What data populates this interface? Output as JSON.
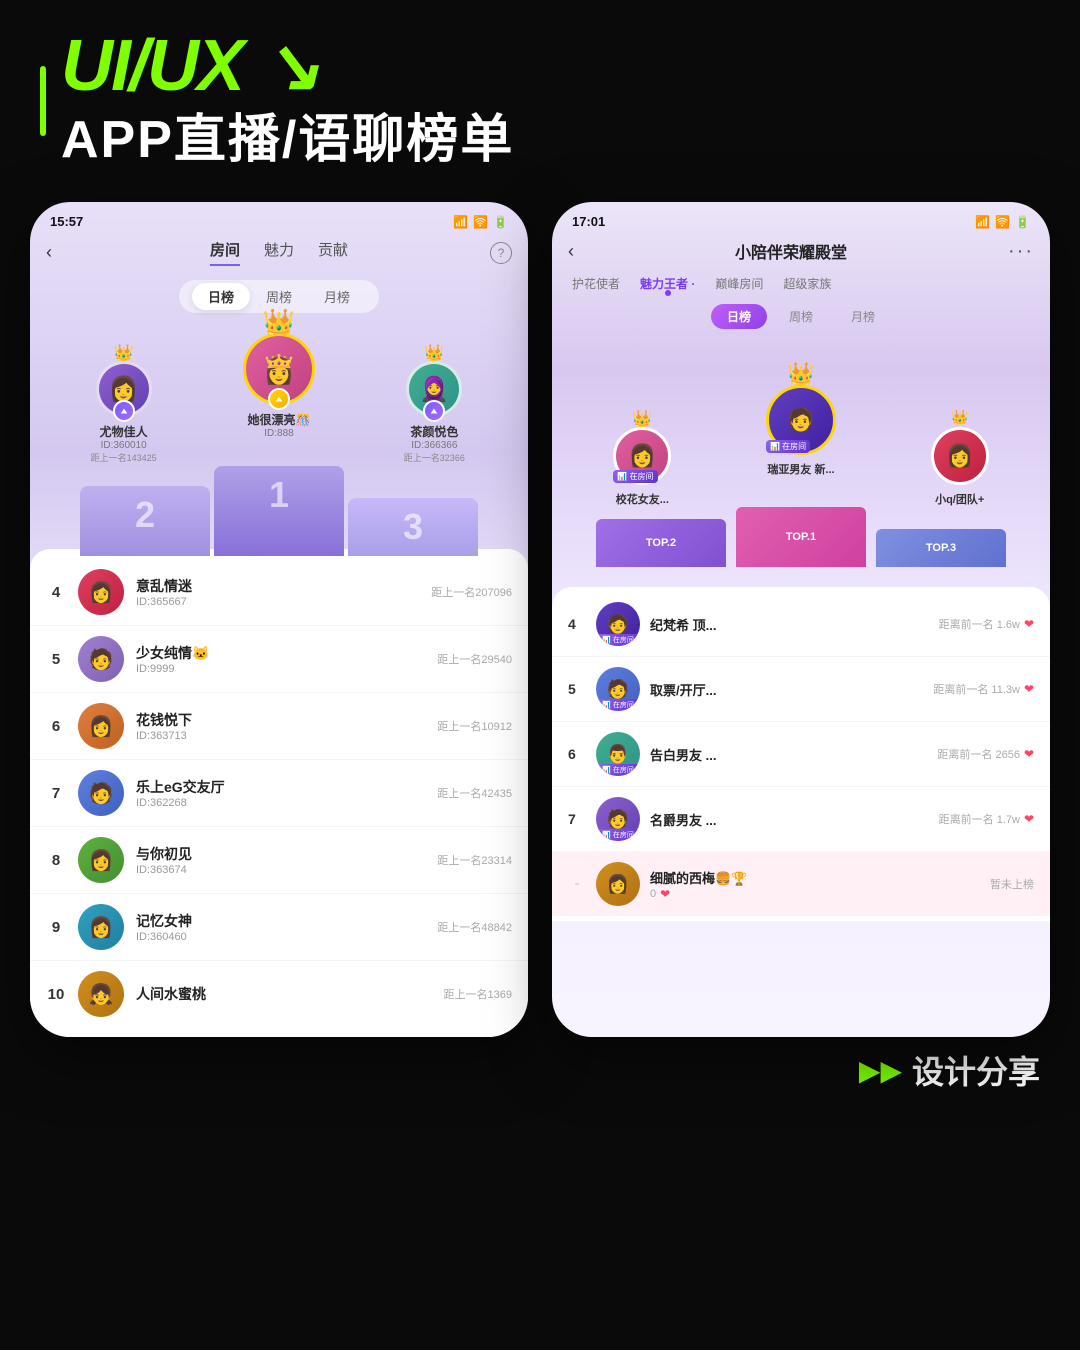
{
  "header": {
    "bar_color": "#7fff00",
    "title_uiux": "UI/UX ↘",
    "title_sub": "APP直播/语聊榜单"
  },
  "phone1": {
    "status_time": "15:57",
    "nav_tabs": [
      "房间",
      "魅力",
      "贡献"
    ],
    "active_nav": "房间",
    "period_tabs": [
      "日榜",
      "周榜",
      "月榜"
    ],
    "active_period": "日榜",
    "podium": [
      {
        "rank": 2,
        "name": "尤物佳人",
        "id": "ID:360010",
        "dist": "距上一名143425",
        "emoji": "👩"
      },
      {
        "rank": 1,
        "name": "她很漂亮🎊",
        "id": "ID:888",
        "dist": "",
        "emoji": "👸"
      },
      {
        "rank": 3,
        "name": "茶颜悦色",
        "id": "ID:366366",
        "dist": "距上一名32366",
        "emoji": "🧕"
      }
    ],
    "list": [
      {
        "rank": 4,
        "name": "意乱情迷",
        "id": "ID:365667",
        "dist": "距上一名207096",
        "emoji": "👩"
      },
      {
        "rank": 5,
        "name": "少女纯情🐱",
        "id": "ID:9999",
        "dist": "距上一名29540",
        "emoji": "🧑"
      },
      {
        "rank": 6,
        "name": "花钱悦下",
        "id": "ID:363713",
        "dist": "距上一名10912",
        "emoji": "👩"
      },
      {
        "rank": 7,
        "name": "乐上eG交友厅",
        "id": "ID:362268",
        "dist": "距上一名42435",
        "emoji": "🧑"
      },
      {
        "rank": 8,
        "name": "与你初见",
        "id": "ID:363674",
        "dist": "距上一名23314",
        "emoji": "👩"
      },
      {
        "rank": 9,
        "name": "记忆女神",
        "id": "ID:360460",
        "dist": "距上一名48842",
        "emoji": "👩"
      },
      {
        "rank": 10,
        "name": "人间水蜜桃",
        "id": "",
        "dist": "距上一名1369",
        "emoji": "👧"
      }
    ]
  },
  "phone2": {
    "status_time": "17:01",
    "title": "小陪伴荣耀殿堂",
    "cat_tabs": [
      "护花使者",
      "魅力王者",
      "巅峰房间",
      "超级家族"
    ],
    "active_cat": "魅力王者",
    "period_tabs": [
      "日榜",
      "周榜",
      "月榜"
    ],
    "active_period": "日榜",
    "podium": [
      {
        "rank": 2,
        "name": "校花女友...",
        "online": "在房间",
        "emoji": "👩"
      },
      {
        "rank": 1,
        "name": "瑞亚男友 新...",
        "online": "在房间",
        "sub": "瑞亚",
        "emoji": "🧑"
      },
      {
        "rank": 3,
        "name": "小q/团队+",
        "emoji": "👩"
      }
    ],
    "list": [
      {
        "rank": 4,
        "name": "纪梵希 顶...",
        "dist": "距离前一名 1.6w",
        "online": true,
        "emoji": "🧑"
      },
      {
        "rank": 5,
        "name": "取票/开厅...",
        "dist": "距离前一名 11.3w",
        "online": true,
        "emoji": "🧑"
      },
      {
        "rank": 6,
        "name": "告白男友 ...",
        "dist": "距离前一名 2656",
        "online": true,
        "emoji": "👨"
      },
      {
        "rank": 7,
        "name": "名爵男友 ...",
        "dist": "距离前一名 1.7w",
        "online": true,
        "emoji": "🧑"
      }
    ],
    "bottom_item": {
      "name": "细腻的西梅🍔🏆",
      "score": "0",
      "status": "暂未上榜",
      "emoji": "👩"
    }
  },
  "footer": {
    "arrows": "▶▶",
    "text": "设计分享"
  }
}
